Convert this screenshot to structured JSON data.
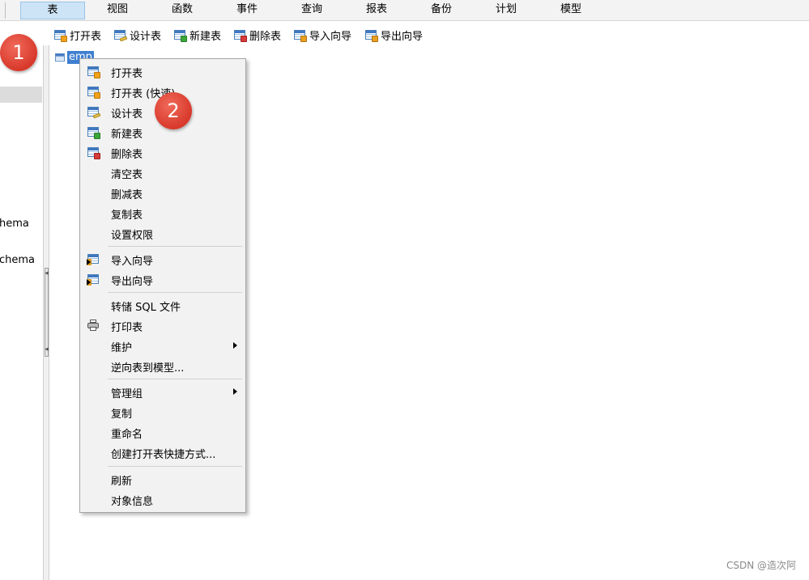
{
  "menu_tabs": [
    "表",
    "视图",
    "函数",
    "事件",
    "查询",
    "报表",
    "备份",
    "计划",
    "模型"
  ],
  "active_tab": "表",
  "toolbar": [
    {
      "label": "打开表",
      "icon": "open-table-icon"
    },
    {
      "label": "设计表",
      "icon": "design-table-icon"
    },
    {
      "label": "新建表",
      "icon": "new-table-icon"
    },
    {
      "label": "删除表",
      "icon": "delete-table-icon"
    },
    {
      "label": "导入向导",
      "icon": "import-wizard-icon"
    },
    {
      "label": "导出向导",
      "icon": "export-wizard-icon"
    }
  ],
  "left_panel": {
    "texts": [
      "hema",
      "chema"
    ]
  },
  "object_list": {
    "selected_item": "emp"
  },
  "context_menu": {
    "items": [
      {
        "label": "打开表",
        "icon": "open-table-icon"
      },
      {
        "label": "打开表 (快速)",
        "icon": "open-table-fast-icon"
      },
      {
        "label": "设计表",
        "icon": "design-table-icon"
      },
      {
        "label": "新建表",
        "icon": "new-table-icon"
      },
      {
        "label": "删除表",
        "icon": "delete-table-icon"
      },
      {
        "label": "清空表"
      },
      {
        "label": "删减表"
      },
      {
        "label": "复制表"
      },
      {
        "label": "设置权限"
      },
      {
        "label": "导入向导",
        "icon": "import-wizard-icon"
      },
      {
        "label": "导出向导",
        "icon": "export-wizard-icon"
      },
      {
        "label": "转储 SQL 文件"
      },
      {
        "label": "打印表",
        "icon": "printer-icon"
      },
      {
        "label": "维护",
        "submenu": true
      },
      {
        "label": "逆向表到模型..."
      },
      {
        "label": "管理组",
        "submenu": true
      },
      {
        "label": "复制"
      },
      {
        "label": "重命名"
      },
      {
        "label": "创建打开表快捷方式..."
      },
      {
        "label": "刷新"
      },
      {
        "label": "对象信息"
      }
    ]
  },
  "annotations": [
    "1",
    "2"
  ],
  "watermark": "CSDN @造次阿"
}
